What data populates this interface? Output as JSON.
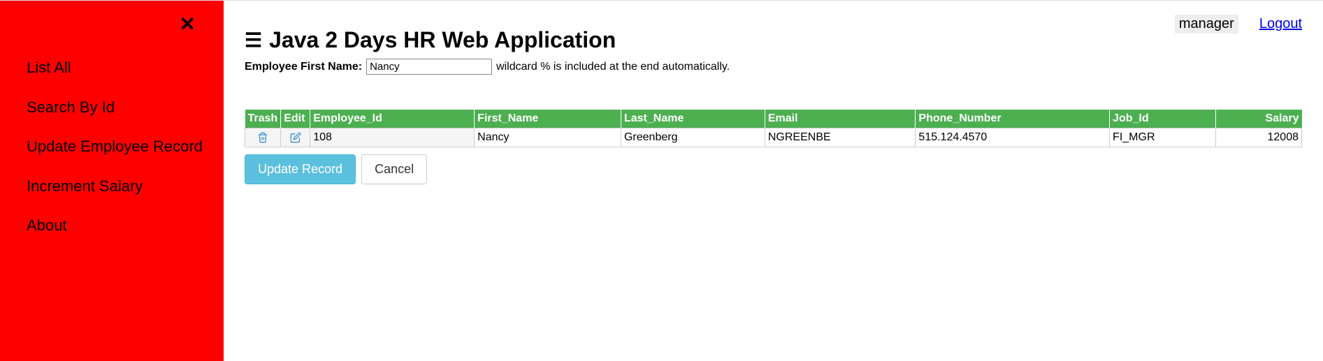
{
  "sidebar": {
    "items": [
      {
        "label": "List All"
      },
      {
        "label": "Search By Id"
      },
      {
        "label": "Update Employee Record"
      },
      {
        "label": "Increment Salary"
      },
      {
        "label": "About"
      }
    ]
  },
  "header": {
    "title": "Java 2 Days HR Web Application",
    "user": "manager",
    "logout_label": "Logout"
  },
  "search": {
    "label": "Employee First Name:",
    "value": "Nancy",
    "hint": "wildcard % is included at the end automatically."
  },
  "table": {
    "headers": {
      "trash": "Trash",
      "edit": "Edit",
      "employee_id": "Employee_Id",
      "first_name": "First_Name",
      "last_name": "Last_Name",
      "email": "Email",
      "phone": "Phone_Number",
      "job_id": "Job_Id",
      "salary": "Salary"
    },
    "rows": [
      {
        "employee_id": "108",
        "first_name": "Nancy",
        "last_name": "Greenberg",
        "email": "NGREENBE",
        "phone": "515.124.4570",
        "job_id": "FI_MGR",
        "salary": "12008"
      }
    ]
  },
  "buttons": {
    "update": "Update Record",
    "cancel": "Cancel"
  }
}
